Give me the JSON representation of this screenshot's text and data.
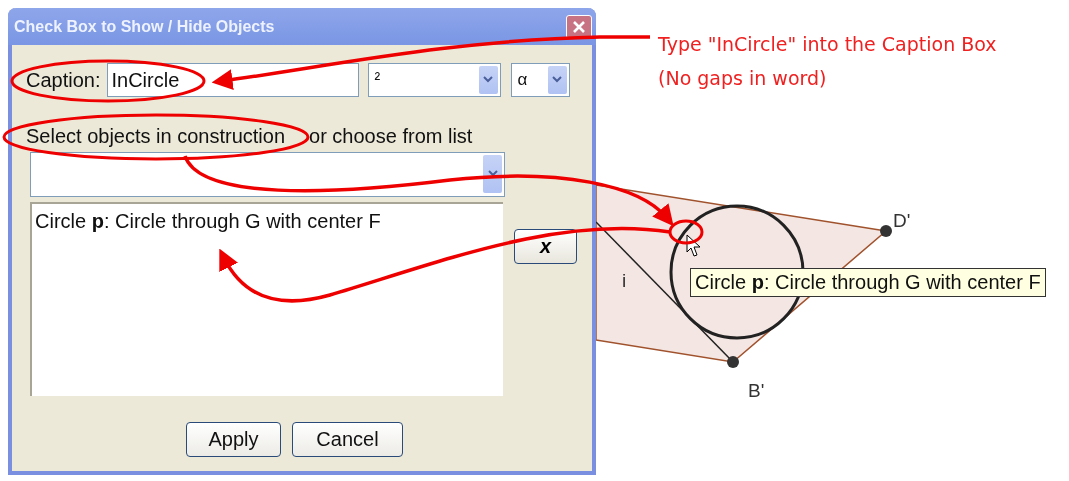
{
  "dialog": {
    "title": "Check Box to Show / Hide Objects",
    "caption_label": "Caption:",
    "caption_value": "InCircle",
    "symbol_combo": "²",
    "greek_combo": "α",
    "select_label": [
      "Select objects in construction",
      "or choose from list"
    ],
    "objects": [
      "Circle **p**: Circle through G with center F"
    ],
    "delete_button": "x",
    "buttons": [
      "Apply",
      "Cancel"
    ]
  },
  "canvas": {
    "points": [
      {
        "label": "D'"
      },
      {
        "label": "B'"
      }
    ],
    "line_label": "i",
    "tooltip": "Circle **p**: Circle through G with center F"
  },
  "annotation": {
    "lines": [
      "Type \"InCircle\" into the Caption Box",
      "(No gaps in word)"
    ]
  }
}
